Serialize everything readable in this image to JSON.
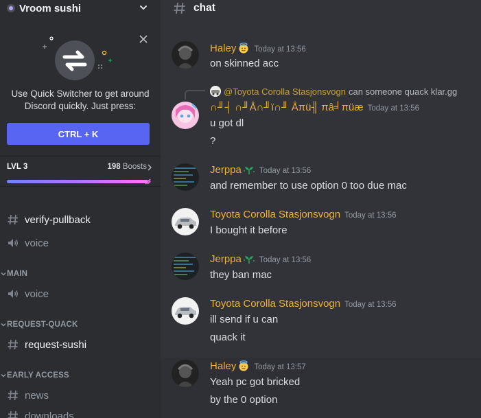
{
  "server": {
    "name": "Vroom sushi"
  },
  "quick_switcher": {
    "text": "Use Quick Switcher to get around Discord quickly. Just press:",
    "shortcut": "CTRL + K"
  },
  "boost": {
    "level": "LVL 3",
    "count": "198",
    "count_suffix": "Boosts",
    "progress": 0.98
  },
  "channels": {
    "verify": "verify-pullback",
    "voice1": "voice",
    "cat_main": "MAIN",
    "voice2": "voice",
    "cat_request": "REQUEST-QUACK",
    "request": "request-sushi",
    "cat_early": "EARLY ACCESS",
    "news": "news",
    "downloads": "downloads"
  },
  "chat": {
    "title": "chat"
  },
  "messages": [
    {
      "author": "Haley",
      "timestamp": "Today at 13:56",
      "lines": [
        "on skinned acc"
      ]
    },
    {
      "reply_name": "@Toyota Corolla Stasjonsvogn",
      "reply_text": "can someone quack klar.gg",
      "author": "∩╜┤ ∩╜Å∩╜ï∩╜ Åπü╢ πâ╛πüæ",
      "timestamp": "Today at 13:56",
      "lines": [
        "u got dl",
        "?"
      ]
    },
    {
      "author": "Jerppa",
      "timestamp": "Today at 13:56",
      "lines": [
        "and remember to use option 0 too due mac"
      ]
    },
    {
      "author": "Toyota Corolla Stasjonsvogn",
      "timestamp": "Today at 13:56",
      "lines": [
        "I bought it before"
      ]
    },
    {
      "author": "Jerppa",
      "timestamp": "Today at 13:56",
      "lines": [
        "they ban mac"
      ]
    },
    {
      "author": "Toyota Corolla Stasjonsvogn",
      "timestamp": "Today at 13:56",
      "lines": [
        "ill send if u can",
        "quack it"
      ]
    },
    {
      "author": "Haley",
      "timestamp": "Today at 13:57",
      "lines": [
        "Yeah pc got bricked",
        "by the 0 option"
      ]
    }
  ],
  "colors": {
    "accent": "#5865f2",
    "author": "#f0b232",
    "background": "#313338",
    "sidebar": "#2b2d31"
  }
}
